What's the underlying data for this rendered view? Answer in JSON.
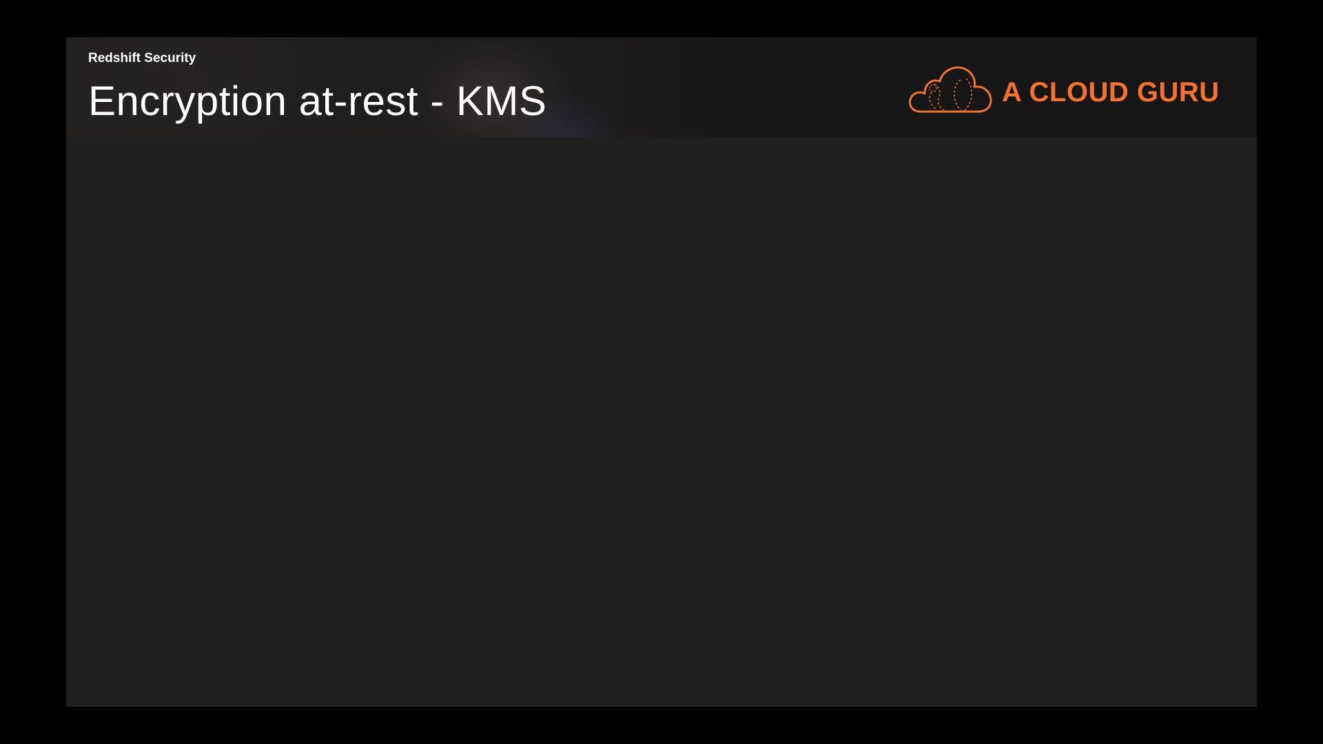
{
  "slide": {
    "section": "Redshift Security",
    "title": "Encryption at-rest - KMS"
  },
  "brand": {
    "name": "A CLOUD GURU",
    "logo_icon": "cloud-icon",
    "accent_color": "#f4722b"
  },
  "colors": {
    "letterbox": "#000000",
    "slide_background": "#1f1f1f",
    "title_text": "#ffffff"
  }
}
